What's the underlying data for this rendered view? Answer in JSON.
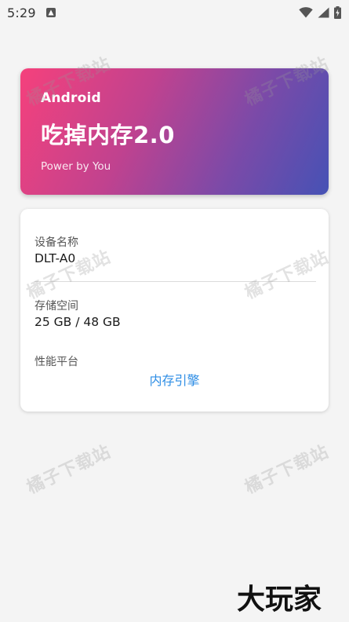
{
  "status_bar": {
    "time": "5:29",
    "icons": [
      "app-notification-icon",
      "wifi-icon",
      "cellular-signal-icon",
      "battery-charging-icon"
    ]
  },
  "header": {
    "platform": "Android",
    "title": "吃掉内存2.0",
    "subtitle": "Power by You",
    "gradient": [
      "#f5417c",
      "#4652b5"
    ]
  },
  "info": {
    "device_name_label": "设备名称",
    "device_name_value": "DLT-A0",
    "storage_label": "存储空间",
    "storage_value": "25 GB / 48 GB",
    "performance_label": "性能平台",
    "engine_link": "内存引擎"
  },
  "watermark_text": "橘子下载站",
  "bottom_logo": "大玩家",
  "colors": {
    "link": "#2f8ee5",
    "background": "#f4f4f4"
  }
}
